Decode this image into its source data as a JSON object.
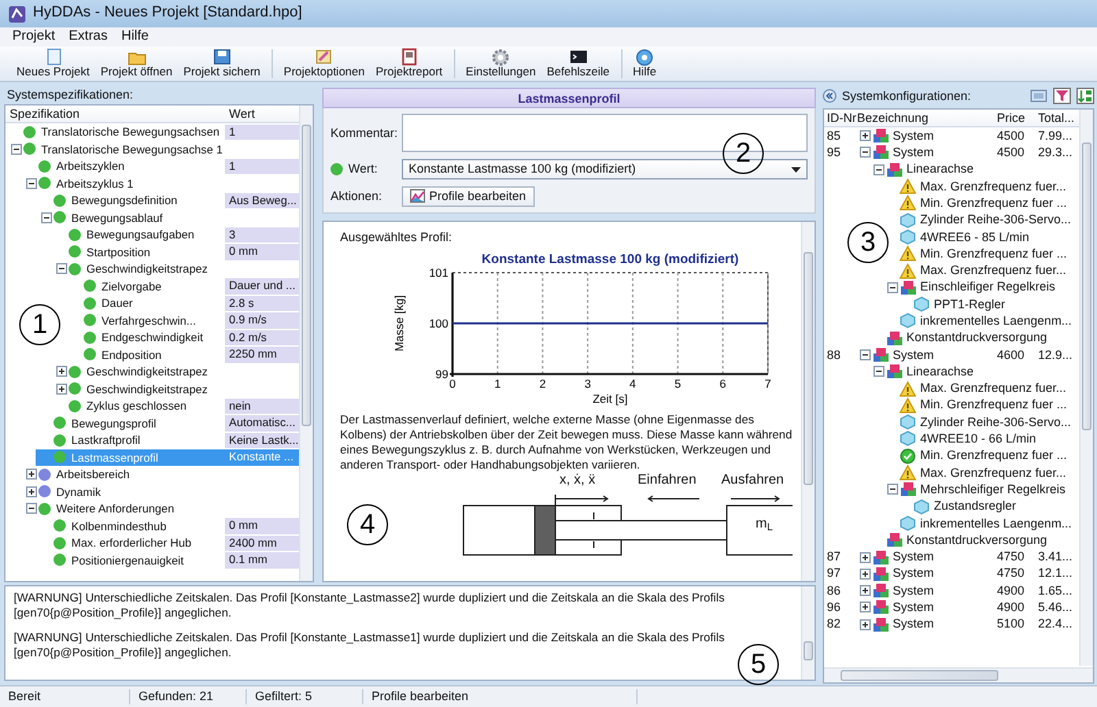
{
  "window": {
    "title": "HyDDAs - Neues Projekt [Standard.hpo]"
  },
  "menu": [
    "Projekt",
    "Extras",
    "Hilfe"
  ],
  "toolbar": [
    {
      "label": "Neues Projekt",
      "kind": "new",
      "separator_before": false
    },
    {
      "label": "Projekt öffnen",
      "kind": "open",
      "separator_before": false
    },
    {
      "label": "Projekt sichern",
      "kind": "save",
      "separator_before": false
    },
    {
      "label": "Projektoptionen",
      "kind": "options",
      "separator_before": true
    },
    {
      "label": "Projektreport",
      "kind": "report",
      "separator_before": false
    },
    {
      "label": "Einstellungen",
      "kind": "settings",
      "separator_before": true
    },
    {
      "label": "Befehlszeile",
      "kind": "console",
      "separator_before": false
    },
    {
      "label": "Hilfe",
      "kind": "help",
      "separator_before": true
    }
  ],
  "spec": {
    "title": "Systemspezifikationen:",
    "columns": [
      "Spezifikation",
      "Wert"
    ],
    "rows": [
      {
        "label": "Translatorische Bewegungsachsen",
        "value": "1",
        "color": "#44b944",
        "selected": false
      },
      {
        "label": "Translatorische Bewegungsachse 1",
        "color": "#44b944",
        "selected": false,
        "expanded": true,
        "children": [
          {
            "label": "Arbeitszyklen",
            "value": "1",
            "color": "#44b944",
            "selected": false
          },
          {
            "label": "Arbeitszyklus 1",
            "color": "#44b944",
            "selected": false,
            "expanded": true,
            "children": [
              {
                "label": "Bewegungsdefinition",
                "value": "Aus Beweg...",
                "color": "#44b944",
                "selected": false
              },
              {
                "label": "Bewegungsablauf",
                "color": "#44b944",
                "selected": false,
                "expanded": true,
                "children": [
                  {
                    "label": "Bewegungsaufgaben",
                    "value": "3",
                    "color": "#44b944",
                    "selected": false
                  },
                  {
                    "label": "Startposition",
                    "value": "0 mm",
                    "color": "#44b944",
                    "selected": false
                  },
                  {
                    "label": "Geschwindigkeitstrapez",
                    "color": "#44b944",
                    "selected": false,
                    "expanded": true,
                    "children": [
                      {
                        "label": "Zielvorgabe",
                        "value": "Dauer und ...",
                        "color": "#44b944",
                        "selected": false
                      },
                      {
                        "label": "Dauer",
                        "value": "2.8 s",
                        "color": "#44b944",
                        "selected": false
                      },
                      {
                        "label": "Verfahrgeschwin...",
                        "value": "0.9 m/s",
                        "color": "#44b944",
                        "selected": false
                      },
                      {
                        "label": "Endgeschwindigkeit",
                        "value": "0.2 m/s",
                        "color": "#44b944",
                        "selected": false
                      },
                      {
                        "label": "Endposition",
                        "value": "2250 mm",
                        "color": "#44b944",
                        "selected": false
                      }
                    ]
                  },
                  {
                    "label": "Geschwindigkeitstrapez",
                    "color": "#44b944",
                    "selected": false,
                    "expanded": false
                  },
                  {
                    "label": "Geschwindigkeitstrapez",
                    "color": "#44b944",
                    "selected": false,
                    "expanded": false
                  },
                  {
                    "label": "Zyklus geschlossen",
                    "value": "nein",
                    "color": "#44b944",
                    "selected": false
                  }
                ]
              },
              {
                "label": "Bewegungsprofil",
                "value": "Automatisc...",
                "color": "#44b944",
                "selected": false
              },
              {
                "label": "Lastkraftprofil",
                "value": "Keine Lastk...",
                "color": "#44b944",
                "selected": false
              },
              {
                "label": "Lastmassenprofil",
                "value": "Konstante ...",
                "color": "#44b944",
                "selected": true
              }
            ]
          },
          {
            "label": "Arbeitsbereich",
            "color": "#7f86e0",
            "selected": false,
            "expanded": false
          },
          {
            "label": "Dynamik",
            "color": "#7f86e0",
            "selected": false,
            "expanded": false
          },
          {
            "label": "Weitere Anforderungen",
            "color": "#44b944",
            "selected": false,
            "expanded": true,
            "children": [
              {
                "label": "Kolbenmindesthub",
                "value": "0 mm",
                "color": "#44b944",
                "selected": false
              },
              {
                "label": "Max. erforderlicher Hub",
                "value": "2400 mm",
                "color": "#44b944",
                "selected": false
              },
              {
                "label": "Positioniergenauigkeit",
                "value": "0.1 mm",
                "color": "#44b944",
                "selected": false
              }
            ]
          }
        ]
      }
    ]
  },
  "detail": {
    "title": "Lastmassenprofil",
    "comment_label": "Kommentar:",
    "value_label": "Wert:",
    "value_valid": true,
    "value": "Konstante Lastmasse 100 kg (modifiziert)",
    "actions_label": "Aktionen:",
    "action_button": "Profile bearbeiten",
    "profile_label": "Ausgewähltes Profil:",
    "chart_data": {
      "type": "line",
      "title": "Konstante Lastmasse 100 kg (modifiziert)",
      "xlabel": "Zeit [s]",
      "ylabel": "Masse [kg]",
      "x": [
        0,
        7
      ],
      "series": [
        {
          "color": "#1f2f8f",
          "values": [
            100,
            100
          ]
        }
      ],
      "grid": true,
      "xlim": [
        0,
        7
      ],
      "ylim": [
        99,
        101
      ],
      "xticks": [
        0,
        1,
        2,
        3,
        4,
        5,
        6,
        7
      ],
      "yticks": [
        99,
        100,
        101
      ]
    },
    "description": "Der Lastmassenverlauf definiert, welche externe Masse (ohne Eigenmasse des Kolbens) der Antriebskolben über der Zeit bewegen muss. Diese Masse kann während eines Bewegungszyklus z. B. durch Aufnahme von Werkstücken, Werkzeugen und anderen Transport- oder Handhabungsobjekten variieren.",
    "drawing": {
      "motion_label": "x, ẋ, ẍ",
      "retract_label": "Einfahren",
      "extend_label": "Ausfahren",
      "mass_label": "m$_{L}$"
    }
  },
  "configs": {
    "title": "Systemkonfigurationen:",
    "columns": [
      "ID-Nr",
      "Bezeichnung",
      "Price",
      "Total..."
    ],
    "rows": [
      {
        "id": "85",
        "name": "System",
        "price": "4500",
        "total": "7.99...",
        "kind": "assembly",
        "expanded": false
      },
      {
        "id": "95",
        "name": "System",
        "price": "4500",
        "total": "29.3...",
        "kind": "assembly",
        "expanded": true,
        "children": [
          {
            "name": "Linearachse",
            "kind": "assembly",
            "expanded": true,
            "children": [
              {
                "name": "Max. Grenzfrequenz fuer...",
                "kind": "warning"
              },
              {
                "name": "Min. Grenzfrequenz fuer ...",
                "kind": "warning"
              },
              {
                "name": "Zylinder Reihe-306-Servo...",
                "kind": "part"
              },
              {
                "name": "4WREE6 - 85 L/min",
                "kind": "part"
              },
              {
                "name": "Min. Grenzfrequenz fuer ...",
                "kind": "warning"
              },
              {
                "name": "Max. Grenzfrequenz fuer...",
                "kind": "warning"
              },
              {
                "name": "Einschleifiger Regelkreis",
                "kind": "assembly",
                "expanded": true,
                "children": [
                  {
                    "name": "PPT1-Regler",
                    "kind": "part"
                  }
                ]
              },
              {
                "name": "inkrementelles Laengenm...",
                "kind": "part"
              }
            ]
          },
          {
            "name": "Konstantdruckversorgung",
            "kind": "assembly"
          }
        ]
      },
      {
        "id": "88",
        "name": "System",
        "price": "4600",
        "total": "12.9...",
        "kind": "assembly",
        "expanded": true,
        "children": [
          {
            "name": "Linearachse",
            "kind": "assembly",
            "expanded": true,
            "children": [
              {
                "name": "Max. Grenzfrequenz fuer...",
                "kind": "warning"
              },
              {
                "name": "Min. Grenzfrequenz fuer ...",
                "kind": "warning"
              },
              {
                "name": "Zylinder Reihe-306-Servo...",
                "kind": "part"
              },
              {
                "name": "4WREE10 - 66 L/min",
                "kind": "part"
              },
              {
                "name": "Min. Grenzfrequenz fuer ...",
                "kind": "ok"
              },
              {
                "name": "Max. Grenzfrequenz fuer...",
                "kind": "warning"
              },
              {
                "name": "Mehrschleifiger Regelkreis",
                "kind": "assembly",
                "expanded": true,
                "children": [
                  {
                    "name": "Zustandsregler",
                    "kind": "part"
                  }
                ]
              },
              {
                "name": "inkrementelles Laengenm...",
                "kind": "part"
              }
            ]
          },
          {
            "name": "Konstantdruckversorgung",
            "kind": "assembly"
          }
        ]
      },
      {
        "id": "87",
        "name": "System",
        "price": "4750",
        "total": "3.41...",
        "kind": "assembly",
        "expanded": false
      },
      {
        "id": "97",
        "name": "System",
        "price": "4750",
        "total": "12.1...",
        "kind": "assembly",
        "expanded": false
      },
      {
        "id": "86",
        "name": "System",
        "price": "4900",
        "total": "1.65...",
        "kind": "assembly",
        "expanded": false
      },
      {
        "id": "96",
        "name": "System",
        "price": "4900",
        "total": "5.46...",
        "kind": "assembly",
        "expanded": false
      },
      {
        "id": "82",
        "name": "System",
        "price": "5100",
        "total": "22.4...",
        "kind": "assembly",
        "expanded": false
      }
    ]
  },
  "log": [
    "[WARNUNG] Unterschiedliche Zeitskalen. Das Profil [Konstante_Lastmasse2] wurde dupliziert und die Zeitskala an die Skala des Profils [gen70{p@Position_Profile}] angeglichen.",
    "[WARNUNG] Unterschiedliche Zeitskalen. Das Profil [Konstante_Lastmasse1] wurde dupliziert und die Zeitskala an die Skala des Profils [gen70{p@Position_Profile}] angeglichen."
  ],
  "status_bar": [
    "Bereit",
    "Gefunden: 21",
    "Gefiltert: 5",
    "Profile bearbeiten"
  ],
  "callouts": [
    "1",
    "2",
    "3",
    "4",
    "5"
  ]
}
